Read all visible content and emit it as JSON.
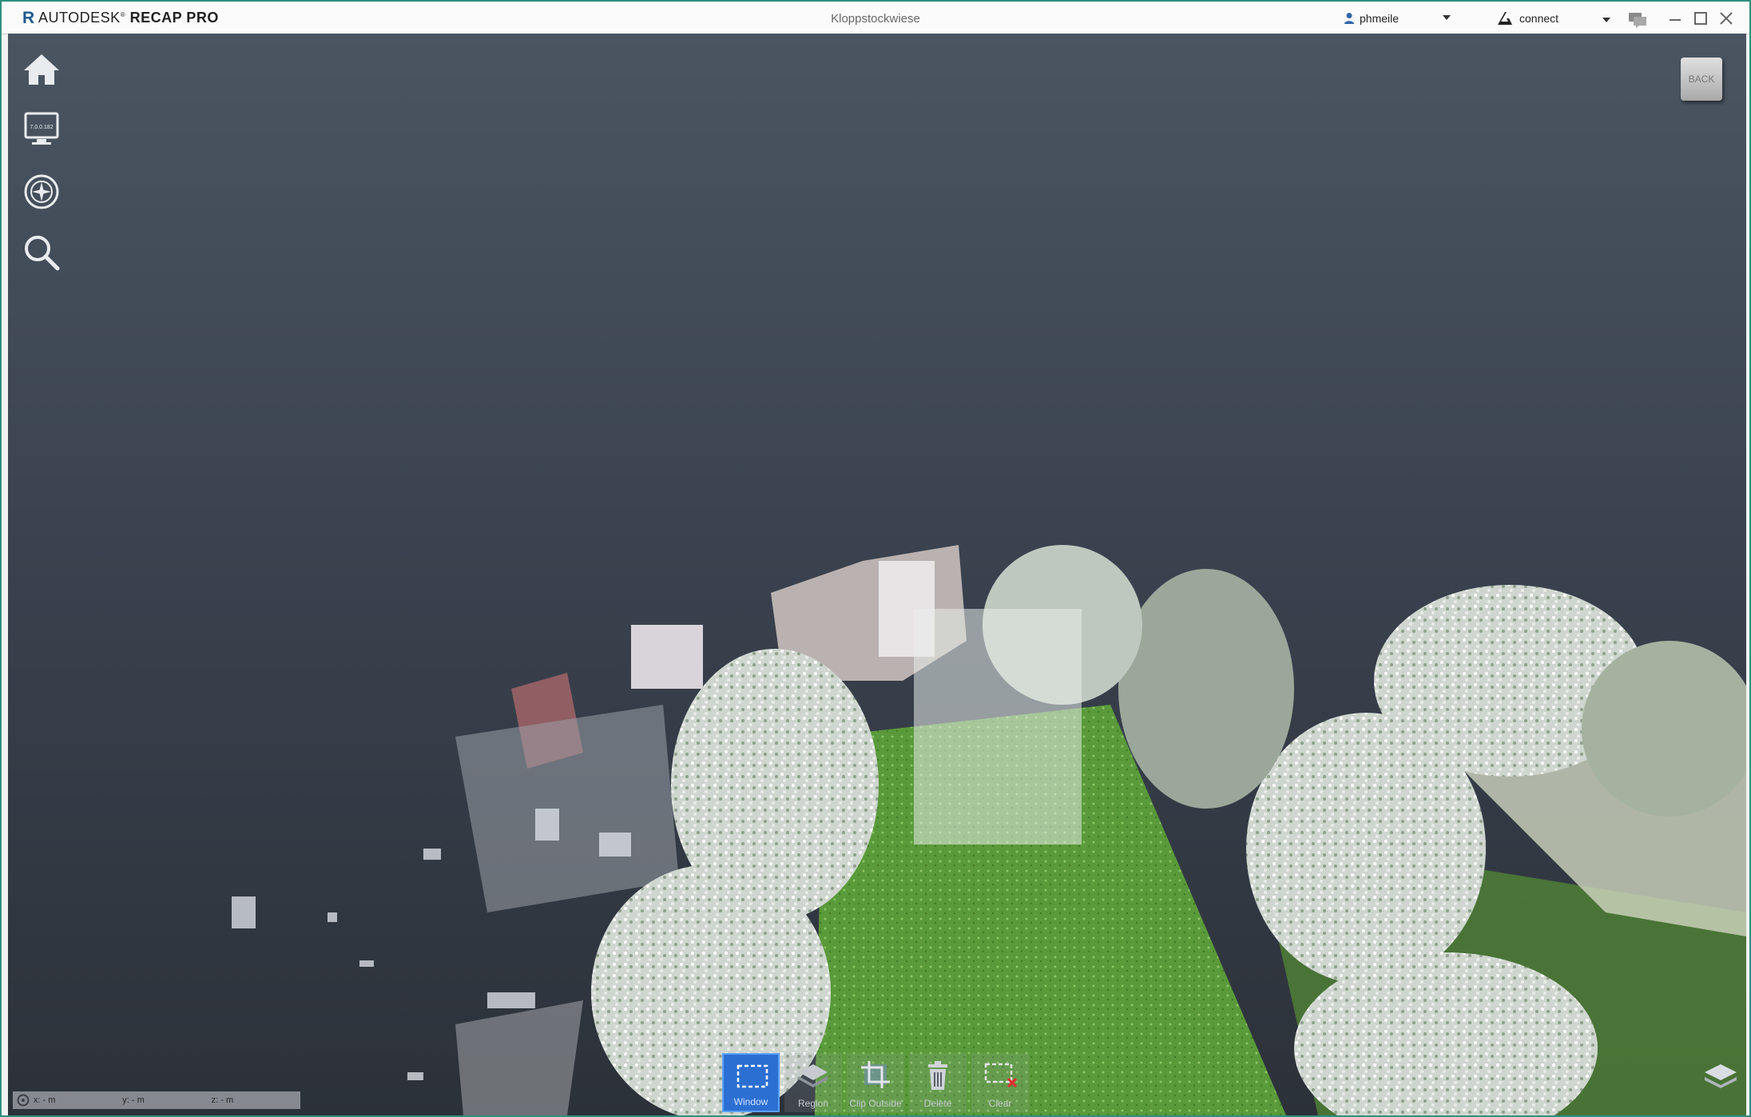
{
  "app": {
    "brand_prefix": "AUTODESK",
    "brand_name": "RECAP PRO",
    "document_title": "Kloppstockwiese"
  },
  "header": {
    "user_name": "phmeile",
    "connect_label": "connect"
  },
  "left_toolbar": [
    {
      "name": "home",
      "icon": "home-icon"
    },
    {
      "name": "display",
      "icon": "monitor-icon",
      "version_text": "7.0.0.182"
    },
    {
      "name": "navigation",
      "icon": "compass-icon"
    },
    {
      "name": "search",
      "icon": "search-icon"
    }
  ],
  "view_cube": {
    "face_label": "BACK"
  },
  "coordinates": {
    "x": "x:  -   m",
    "y": "y:  -   m",
    "z": "z:  -   m"
  },
  "limit_box_toolbar": {
    "buttons": [
      {
        "label": "Window",
        "active": true
      },
      {
        "label": "Region",
        "active": false
      },
      {
        "label": "Clip Outside",
        "active": false
      },
      {
        "label": "Delete",
        "active": false
      },
      {
        "label": "Clear",
        "active": false
      }
    ]
  },
  "colors": {
    "accent": "#2c6fd2",
    "viewport_top": "#4a5561",
    "viewport_bottom": "#2c3139",
    "brand": "#1e5a8e"
  }
}
